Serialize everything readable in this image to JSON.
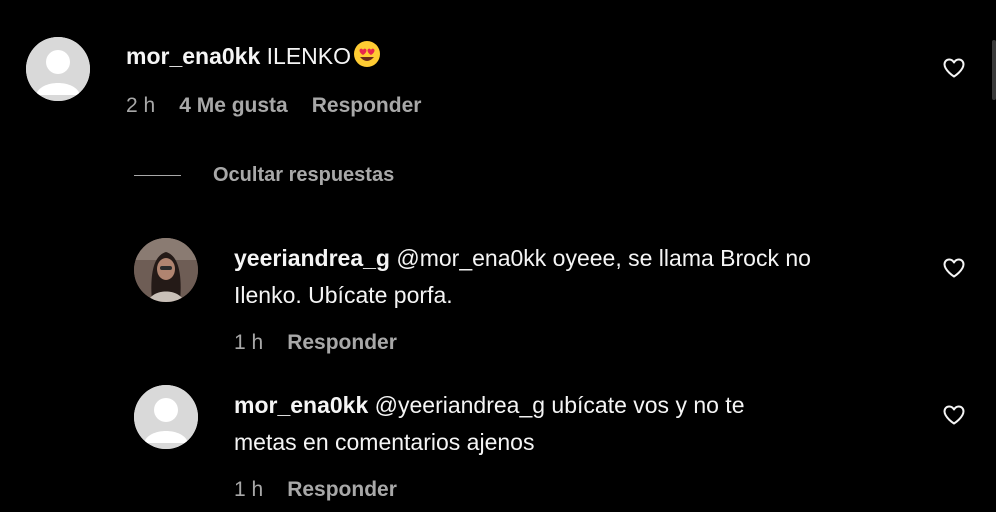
{
  "comments": [
    {
      "username": "mor_ena0kk",
      "text": "ILENKO",
      "emoji": "heart-eyes-emoji",
      "time": "2 h",
      "likes": "4 Me gusta",
      "reply_label": "Responder"
    }
  ],
  "hide_replies_label": "Ocultar respuestas",
  "replies": [
    {
      "username": "yeeriandrea_g",
      "text_line1": "@mor_ena0kk oyeee, se llama Brock no",
      "text_line2": "Ilenko. Ubícate porfa.",
      "time": "1 h",
      "reply_label": "Responder"
    },
    {
      "username": "mor_ena0kk",
      "text_line1": "@yeeriandrea_g ubícate vos y no te",
      "text_line2": "metas en comentarios ajenos",
      "time": "1 h",
      "reply_label": "Responder"
    }
  ],
  "colors": {
    "background": "#000000",
    "text": "#f5f5f5",
    "muted": "#a8a8a8",
    "avatar_placeholder": "#d9d9d9"
  },
  "icons": [
    "heart-outline-icon",
    "default-avatar-icon",
    "heart-eyes-emoji"
  ]
}
